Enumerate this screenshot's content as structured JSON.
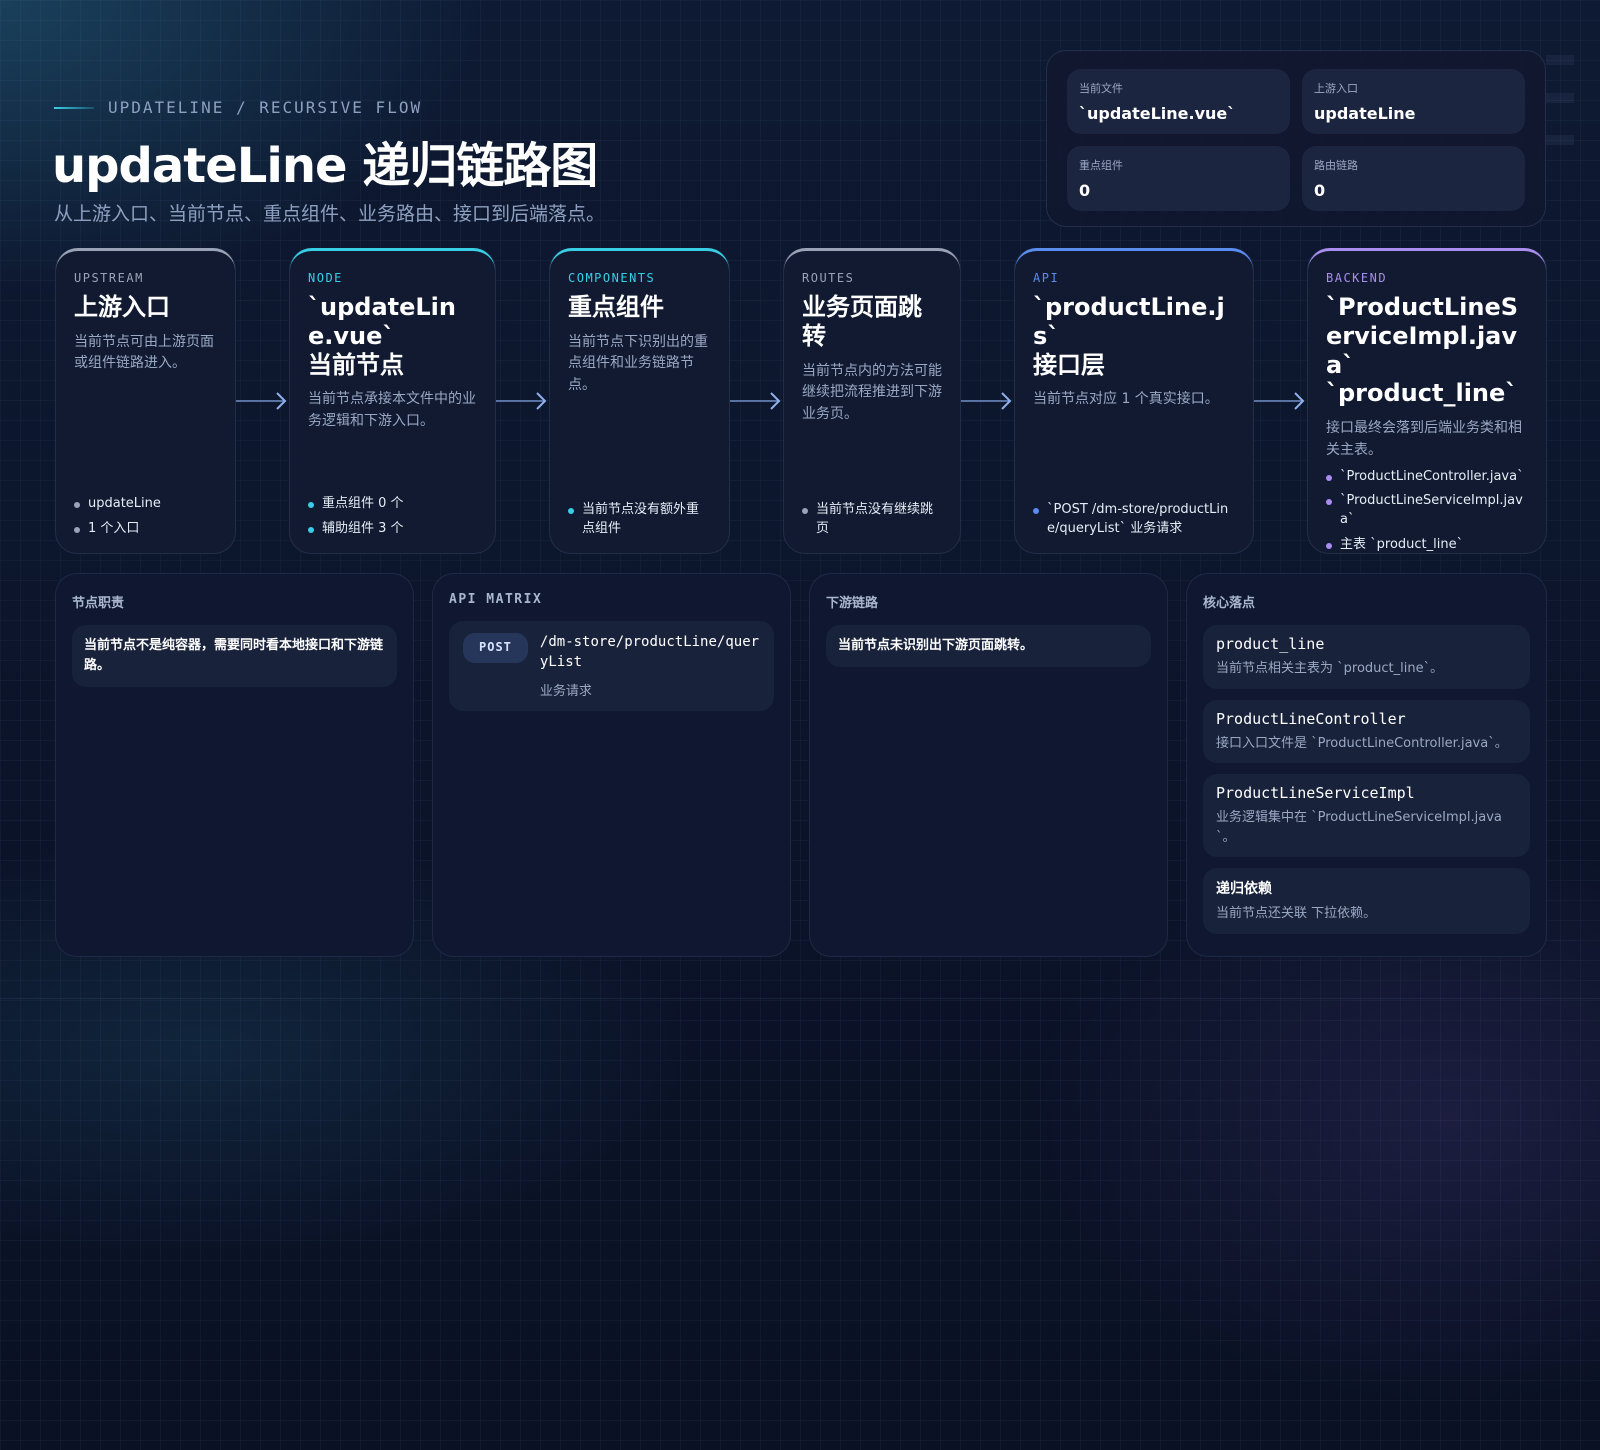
{
  "header": {
    "eyebrow": "UPDATELINE / RECURSIVE FLOW",
    "title": "updateLine 递归链路图",
    "subtitle": "从上游入口、当前节点、重点组件、业务路由、接口到后端落点。"
  },
  "stats": [
    {
      "label": "当前文件",
      "value": "`updateLine.vue`"
    },
    {
      "label": "上游入口",
      "value": "updateLine"
    },
    {
      "label": "重点组件",
      "value": "0"
    },
    {
      "label": "路由链路",
      "value": "0"
    }
  ],
  "cards": [
    {
      "tag": "UPSTREAM",
      "title": "上游入口",
      "desc": "当前节点可由上游页面或组件链路进入。",
      "bullets": [
        "updateLine",
        "1 个入口"
      ]
    },
    {
      "tag": "NODE",
      "title": "`updateLine.vue`\n当前节点",
      "desc": "当前节点承接本文件中的业务逻辑和下游入口。",
      "bullets": [
        "重点组件 0 个",
        "辅助组件 3 个"
      ]
    },
    {
      "tag": "COMPONENTS",
      "title": "重点组件",
      "desc": "当前节点下识别出的重点组件和业务链路节点。",
      "bullets": [
        "当前节点没有额外重点组件"
      ]
    },
    {
      "tag": "ROUTES",
      "title": "业务页面跳转",
      "desc": "当前节点内的方法可能继续把流程推进到下游业务页。",
      "bullets": [
        "当前节点没有继续跳页"
      ]
    },
    {
      "tag": "API",
      "title": "`productLine.js`\n接口层",
      "desc": "当前节点对应 1 个真实接口。",
      "bullets": [
        "`POST /dm-store/productLine/queryList` 业务请求"
      ]
    },
    {
      "tag": "BACKEND",
      "title": "`ProductLineServiceImpl.java`\n`product_line`",
      "desc": "接口最终会落到后端业务类和相关主表。",
      "bullets": [
        "`ProductLineController.java`",
        "`ProductLineServiceImpl.java`",
        "主表 `product_line`"
      ]
    }
  ],
  "panels": {
    "duty": {
      "title": "节点职责",
      "note": "当前节点不是纯容器，需要同时看本地接口和下游链路。"
    },
    "api": {
      "title": "API MATRIX",
      "method": "POST",
      "path": "/dm-store/productLine/queryList",
      "desc": "业务请求"
    },
    "downstream": {
      "title": "下游链路",
      "note": "当前节点未识别出下游页面跳转。"
    },
    "core": {
      "title": "核心落点",
      "items": [
        {
          "name": "product_line",
          "desc": "当前节点相关主表为 `product_line`。"
        },
        {
          "name": "ProductLineController",
          "desc": "接口入口文件是 `ProductLineController.java`。"
        },
        {
          "name": "ProductLineServiceImpl",
          "desc": "业务逻辑集中在 `ProductLineServiceImpl.java`。"
        },
        {
          "name": "递归依赖",
          "desc": "当前节点还关联 下拉依赖。"
        }
      ]
    }
  },
  "colors": {
    "upstream": "#9aa3b5",
    "node": "#38cfe6",
    "components": "#38cfe6",
    "routes": "#9aa3b5",
    "api": "#5b8cf0",
    "backend": "#a98ef0",
    "arrow": "#6f8fc9"
  }
}
